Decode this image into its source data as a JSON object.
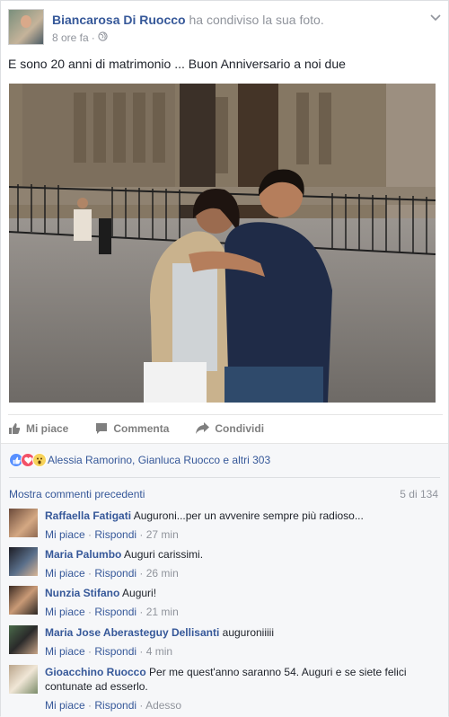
{
  "post": {
    "author": "Biancarosa Di Ruocco",
    "shared_text": "ha condiviso la sua foto.",
    "time": "8 ore fa",
    "separator": "·",
    "privacy_icon": "globe-icon",
    "message": "E sono 20 anni di matrimonio ... Buon Anniversario a noi due"
  },
  "actions": {
    "like": "Mi piace",
    "comment": "Commenta",
    "share": "Condividi"
  },
  "reactions": {
    "icons": [
      "like-icon",
      "love-icon",
      "wow-icon"
    ],
    "summary": "Alessia Ramorino, Gianluca Ruocco e altri 303"
  },
  "comments_header": {
    "show_previous": "Mostra commenti precedenti",
    "count": "5 di 134"
  },
  "comments": [
    {
      "name": "Raffaella Fatigati",
      "text": "Auguroni...per un avvenire sempre più radioso...",
      "like": "Mi piace",
      "reply": "Rispondi",
      "time": "27 min"
    },
    {
      "name": "Maria Palumbo",
      "text": "Auguri carissimi.",
      "like": "Mi piace",
      "reply": "Rispondi",
      "time": "26 min"
    },
    {
      "name": "Nunzia Stifano",
      "text": "Auguri!",
      "like": "Mi piace",
      "reply": "Rispondi",
      "time": "21 min"
    },
    {
      "name": "Maria Jose Aberasteguy Dellisanti",
      "text": "auguroniiiii",
      "like": "Mi piace",
      "reply": "Rispondi",
      "time": "4 min"
    },
    {
      "name": "Gioacchino Ruocco",
      "text": "Per me quest'anno saranno 54. Auguri e se siete felici contunate ad esserlo.",
      "like": "Mi piace",
      "reply": "Rispondi",
      "time": "Adesso"
    }
  ],
  "colors": {
    "link": "#365899",
    "muted": "#90949c",
    "like_blue": "#5890ff",
    "love_red": "#f25268",
    "wow_yellow": "#f7d35b"
  }
}
